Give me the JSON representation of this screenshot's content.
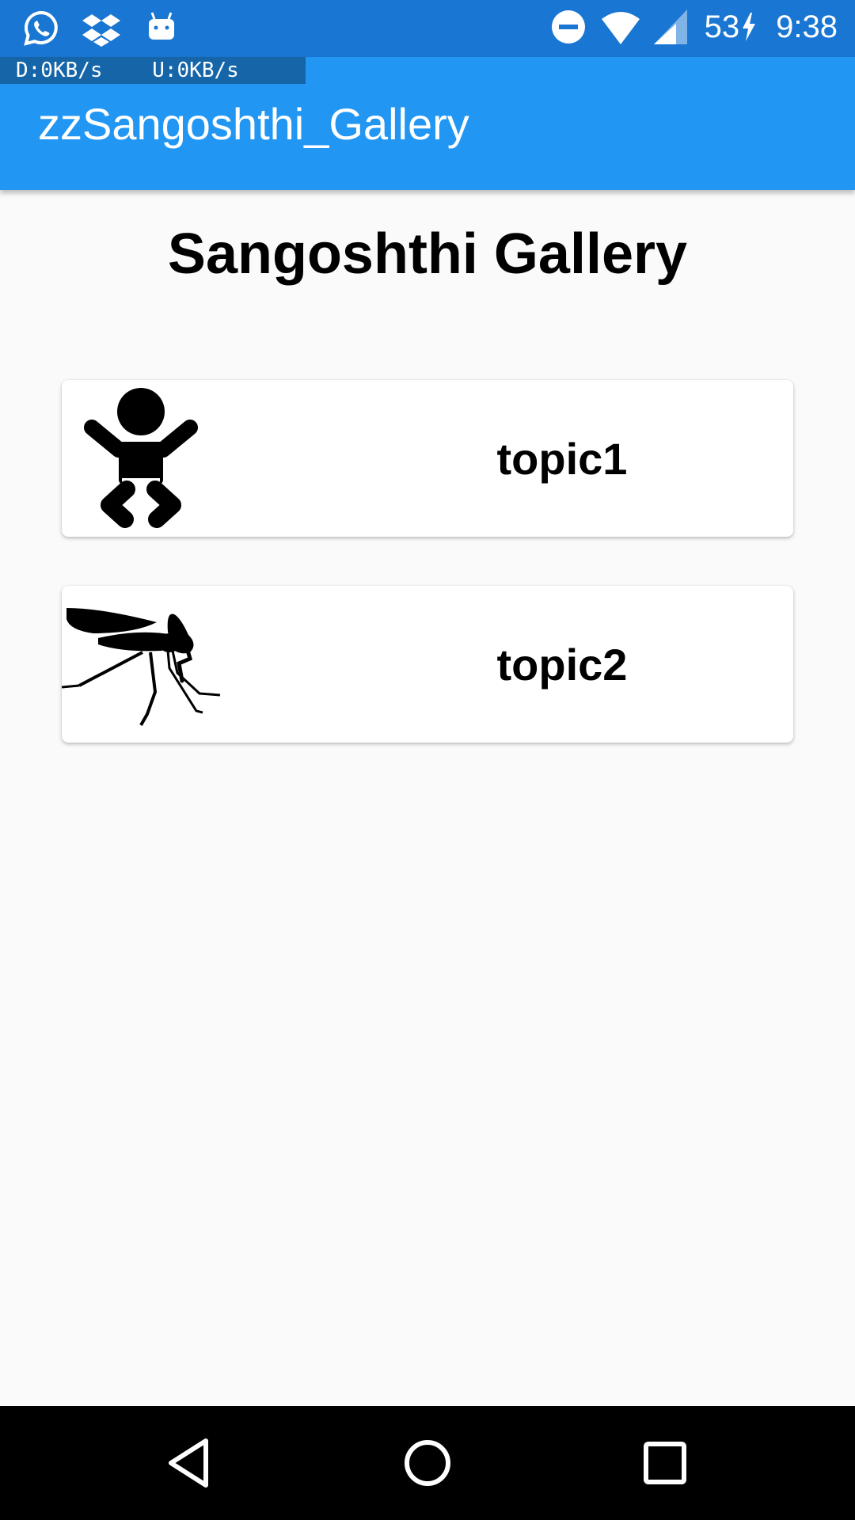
{
  "status_bar": {
    "left_icons": [
      "whatsapp-icon",
      "dropbox-icon",
      "android-icon"
    ],
    "right_icons": [
      "do-not-disturb-icon",
      "wifi-icon",
      "cell-signal-icon",
      "charging-icon"
    ],
    "battery": "53",
    "time": "9:38"
  },
  "net_speed": {
    "download": "D:0KB/s",
    "upload": "U:0KB/s"
  },
  "app_bar": {
    "title": "zzSangoshthi_Gallery",
    "color": "#2196f3"
  },
  "main": {
    "title": "Sangoshthi Gallery",
    "cards": [
      {
        "label": "topic1",
        "icon": "baby-icon"
      },
      {
        "label": "topic2",
        "icon": "mosquito-icon"
      }
    ]
  },
  "nav_bar": {
    "buttons": [
      "back-icon",
      "home-icon",
      "recents-icon"
    ]
  }
}
